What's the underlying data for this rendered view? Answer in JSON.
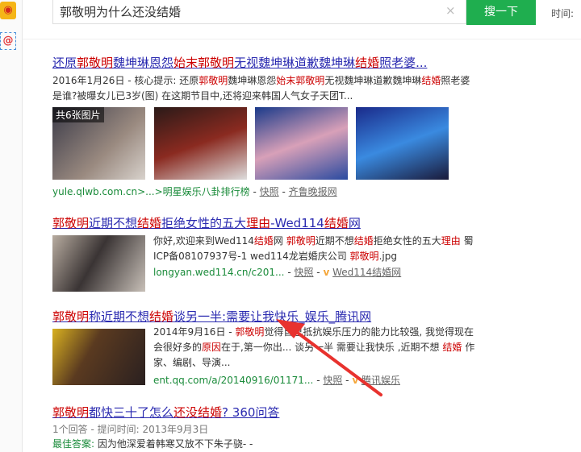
{
  "search": {
    "query": "郭敬明为什么还没结婚",
    "button": "搜一下",
    "time_label": "时间:",
    "clear": "×"
  },
  "sidebar": {
    "weibo": "微博",
    "at": "@"
  },
  "results": [
    {
      "title": [
        [
          "还原",
          0
        ],
        [
          "郭敬明",
          1
        ],
        [
          "魏坤琳恩怨",
          0
        ],
        [
          "始末郭敬明",
          1
        ],
        [
          "无视魏坤琳道歉魏坤琳",
          0
        ],
        [
          "结婚",
          1
        ],
        [
          "照老婆...",
          0
        ]
      ],
      "snippet": [
        [
          "2016年1月26日 - 核心提示: 还原",
          0
        ],
        [
          "郭敬明",
          1
        ],
        [
          "魏坤琳恩怨",
          0
        ],
        [
          "始末郭敬明",
          1
        ],
        [
          "无视魏坤琳道歉魏坤琳",
          0
        ],
        [
          "结婚",
          1
        ],
        [
          "照老婆是谁?被曝女儿已3岁(图) 在这期节目中,还将迎来韩国人气女子天团T...",
          0
        ]
      ],
      "images_badge": "共6张图片",
      "url": "yule.qlwb.com.cn>...>明星娱乐八卦排行榜",
      "snapshot": "快照",
      "source": "齐鲁晚报网"
    },
    {
      "title": [
        [
          "郭敬明",
          1
        ],
        [
          "近期不想",
          0
        ],
        [
          "结婚",
          1
        ],
        [
          "拒绝女性的五大",
          0
        ],
        [
          "理由",
          1
        ],
        [
          "-Wed114",
          0
        ],
        [
          "结婚",
          1
        ],
        [
          "网",
          0
        ]
      ],
      "snippet": [
        [
          "你好,欢迎来到Wed114",
          0
        ],
        [
          "结婚",
          1
        ],
        [
          "网 ",
          0
        ],
        [
          "郭敬明",
          1
        ],
        [
          "近期不想",
          0
        ],
        [
          "结婚",
          1
        ],
        [
          "拒绝女性的五大",
          0
        ],
        [
          "理由",
          1
        ],
        [
          " 蜀ICP备08107937号-1 wed114龙岩婚庆公司 ",
          0
        ],
        [
          "郭敬明",
          1
        ],
        [
          ".jpg",
          0
        ]
      ],
      "url": "longyan.wed114.cn/c201...",
      "snapshot": "快照",
      "source": "Wed114结婚网"
    },
    {
      "title": [
        [
          "郭敬明",
          1
        ],
        [
          "称近期不想",
          0
        ],
        [
          "结婚",
          1
        ],
        [
          "谈另一半:需要让我快乐_娱乐_腾讯网",
          0
        ]
      ],
      "snippet": [
        [
          "2014年9月16日 - ",
          0
        ],
        [
          "郭敬明",
          1
        ],
        [
          "觉得自己抵抗娱乐压力的能力比较强, 我觉得现在会很好多的",
          0
        ],
        [
          "原因",
          1
        ],
        [
          "在于,第一你出... 谈另一半 需要让我快乐 ,近期不想 ",
          0
        ],
        [
          "结婚",
          1
        ],
        [
          " 作家、编剧、导演...",
          0
        ]
      ],
      "url": "ent.qq.com/a/20140916/01171...",
      "snapshot": "快照",
      "source": "腾讯娱乐"
    },
    {
      "title": [
        [
          "郭敬明",
          1
        ],
        [
          "都快三十了怎么",
          0
        ],
        [
          "还没结婚",
          1
        ],
        [
          "? 360问答",
          0
        ]
      ],
      "meta": "1个回答 - 提问时间: 2013年9月3日",
      "best_label": "最佳答案:",
      "best": "因为他深爱着韩寒又放不下朱子骁- -"
    }
  ],
  "colors": {
    "link": "#2a2ab0",
    "highlight": "#cc0000",
    "url": "#1a8b3a",
    "button": "#1fae4f",
    "arrow": "#e8322e"
  }
}
